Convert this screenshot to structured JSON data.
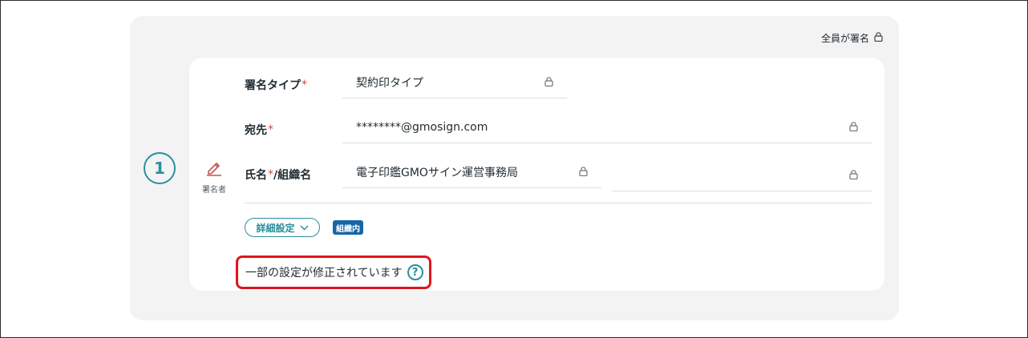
{
  "header": {
    "all_sign_label": "全員が署名",
    "all_sign_icon": "lock-icon"
  },
  "step": {
    "number": "1"
  },
  "signer": {
    "type_label": "署名者",
    "type_icon": "pen-icon"
  },
  "fields": {
    "signature_type": {
      "label": "署名タイプ",
      "required_mark": "*",
      "value": "契約印タイプ"
    },
    "recipient": {
      "label": "宛先",
      "required_mark": "*",
      "value": "********@gmosign.com"
    },
    "name_org": {
      "label_prefix": "氏名",
      "required_mark": "*",
      "label_suffix": "/組織名",
      "name_value": "電子印鑑GMOサイン運営事務局",
      "org_value": ""
    }
  },
  "details": {
    "button_label": "詳細設定",
    "badge": "組織内"
  },
  "notice": {
    "text": "一部の設定が修正されています",
    "help_glyph": "?"
  },
  "colors": {
    "accent": "#2a8f9d",
    "required": "#d04a4a",
    "badge_bg": "#1565a8",
    "highlight": "#e0151b"
  }
}
